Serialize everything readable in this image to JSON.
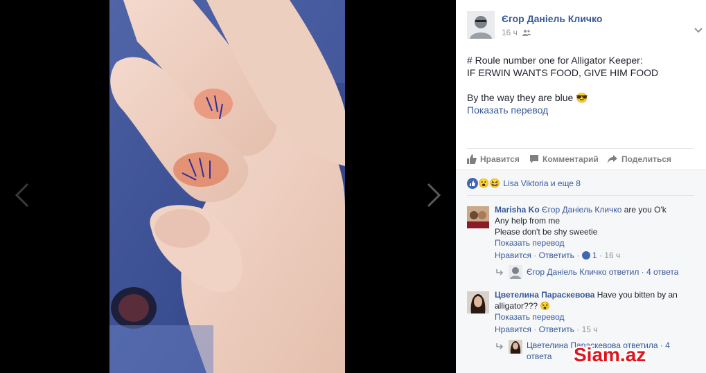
{
  "post": {
    "author": "Єгор Даніель Кличко",
    "time": "16 ч",
    "line1": "# Roule number one for Alligator Keeper:",
    "line2": "IF ERWIN WANTS FOOD, GIVE HIM FOOD",
    "line3": "By the way they are blue",
    "line3_emoji": "😎",
    "translate": "Показать перевод"
  },
  "actions": {
    "like": "Нравится",
    "comment": "Комментарий",
    "share": "Поделиться"
  },
  "reactions": {
    "emojis": [
      "😮",
      "😆"
    ],
    "summary": "Lisa Viktoria и еще 8"
  },
  "comments": [
    {
      "author": "Marisha Ko",
      "mention": "Єгор Даніель Кличко",
      "text1": " are you O'k",
      "text2": "Any help from me",
      "text3": "Please don't be shy sweetie",
      "translate": "Показать перевод",
      "like": "Нравится",
      "reply": "Ответить",
      "like_count": "1",
      "time": "16 ч",
      "reply_summary": "Єгор Даніель Кличко ответил · 4 ответа"
    },
    {
      "author": "Цветелина Параскевова",
      "text1": " Have you bitten by an",
      "text2": "alligator???",
      "text2_emoji": "😵",
      "translate": "Показать перевод",
      "like": "Нравится",
      "reply": "Ответить",
      "time": "15 ч",
      "reply_summary": "Цветелина Параскевова ответила · 4",
      "reply_summary2": "ответа"
    }
  ],
  "watermark": "Siam.az",
  "colors": {
    "link": "#365899",
    "grey": "#90949c",
    "panel_bg": "#ffffff",
    "comments_bg": "#f6f7f9",
    "watermark_red": "#e0141e"
  }
}
